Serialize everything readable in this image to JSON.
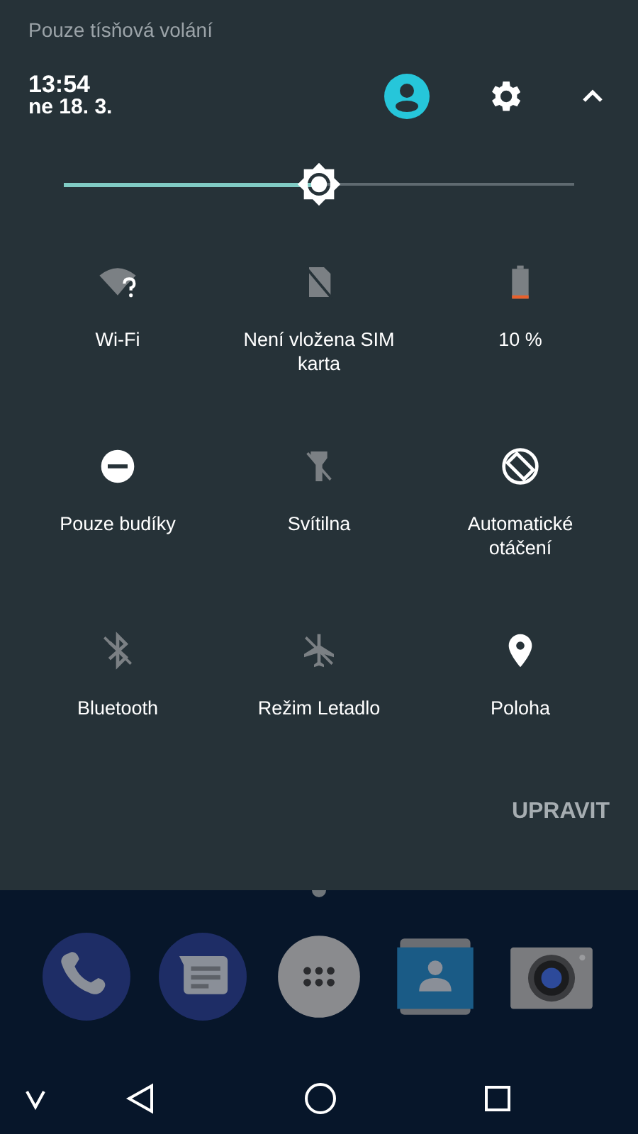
{
  "status_text": "Pouze tísňová volání",
  "header": {
    "time": "13:54",
    "date": "ne 18. 3."
  },
  "brightness": {
    "level": 0.5
  },
  "tiles": [
    {
      "kind": "wifi",
      "label": "Wi-Fi",
      "on": false
    },
    {
      "kind": "sim",
      "label": "Není vložena SIM karta",
      "on": false
    },
    {
      "kind": "battery",
      "label": "10 %",
      "on": false
    },
    {
      "kind": "dnd",
      "label": "Pouze budíky",
      "on": true
    },
    {
      "kind": "flashlight",
      "label": "Svítilna",
      "on": false
    },
    {
      "kind": "rotate",
      "label": "Automatické otáčení",
      "on": true
    },
    {
      "kind": "bluetooth",
      "label": "Bluetooth",
      "on": false
    },
    {
      "kind": "airplane",
      "label": "Režim Letadlo",
      "on": false
    },
    {
      "kind": "location",
      "label": "Poloha",
      "on": true
    }
  ],
  "edit_button": "UPRAVIT",
  "dock": [
    {
      "kind": "phone"
    },
    {
      "kind": "messages"
    },
    {
      "kind": "apps"
    },
    {
      "kind": "contacts"
    },
    {
      "kind": "camera"
    }
  ]
}
